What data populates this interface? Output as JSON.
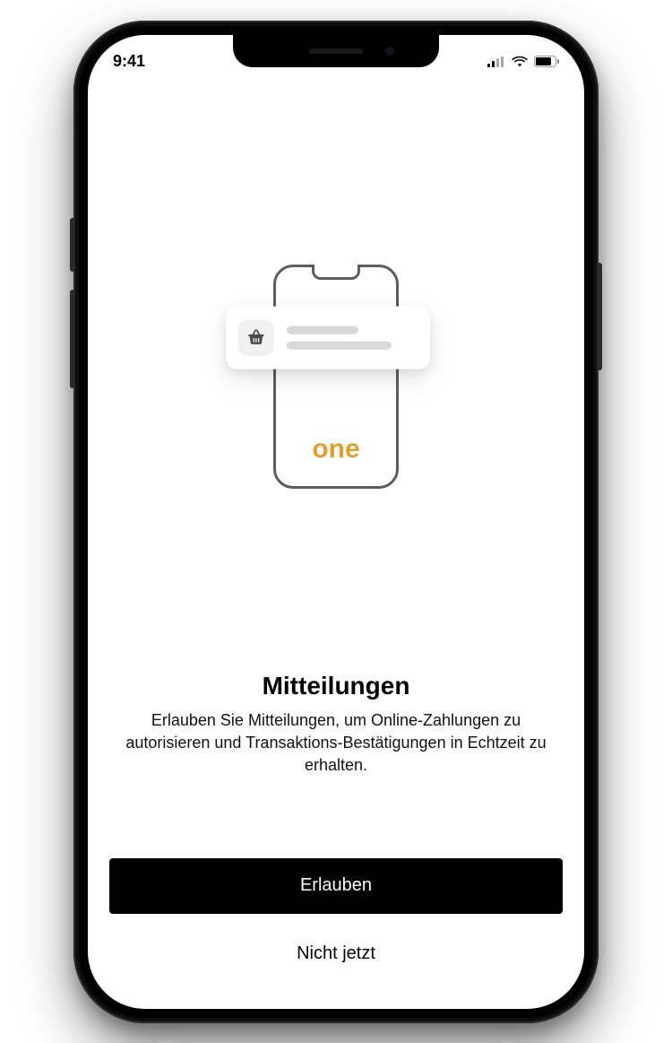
{
  "status_bar": {
    "time": "9:41"
  },
  "illustration": {
    "brand_text": "one",
    "notification_icon_name": "shopping-basket"
  },
  "prompt": {
    "title": "Mitteilungen",
    "description": "Erlauben Sie Mitteilungen, um Online-Zahlungen zu autorisieren und Transaktions-Bestätigungen in Echtzeit zu erhalten."
  },
  "actions": {
    "primary_label": "Erlauben",
    "secondary_label": "Nicht jetzt"
  },
  "colors": {
    "accent": "#e0a030",
    "primary_button_bg": "#000000",
    "primary_button_fg": "#ffffff"
  }
}
